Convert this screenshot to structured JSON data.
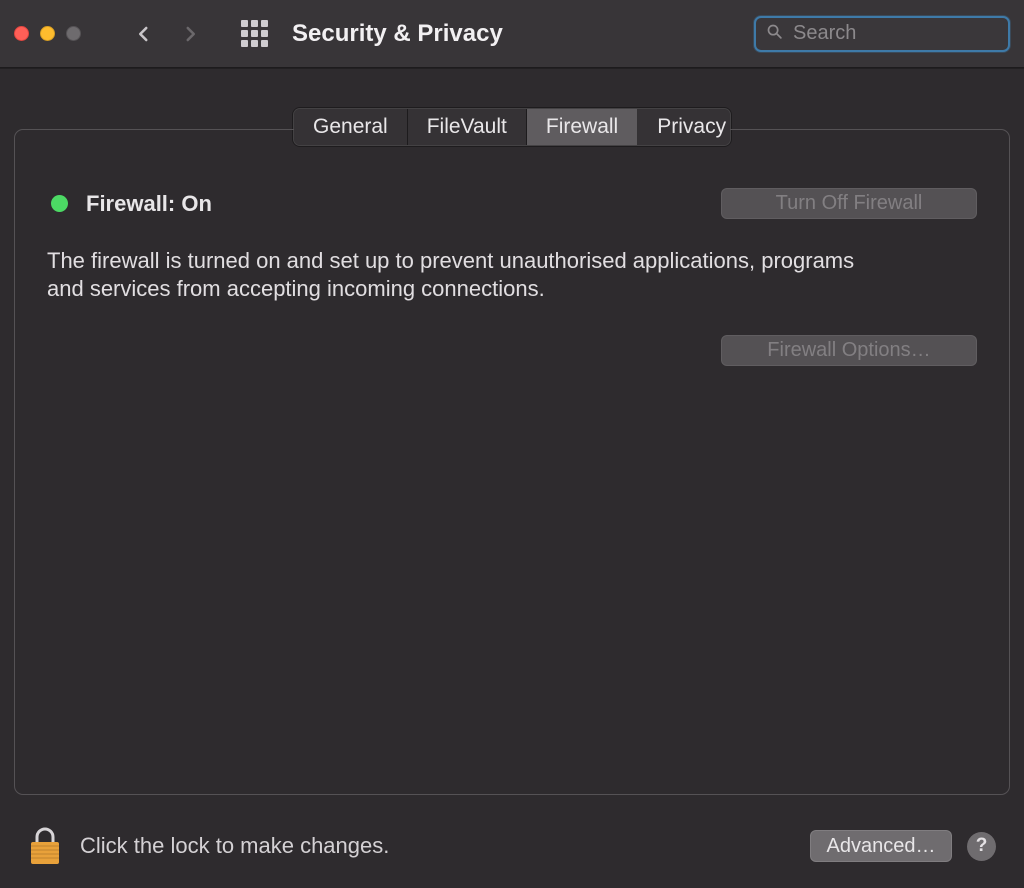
{
  "window": {
    "title": "Security & Privacy"
  },
  "search": {
    "placeholder": "Search"
  },
  "tabs": {
    "general": "General",
    "filevault": "FileVault",
    "firewall": "Firewall",
    "privacy": "Privacy",
    "active": "firewall"
  },
  "firewall": {
    "status_label": "Firewall: On",
    "status_color": "#4cd964",
    "turn_off_label": "Turn Off Firewall",
    "description": "The firewall is turned on and set up to prevent unauthorised applications, programs and services from accepting incoming connections.",
    "options_label": "Firewall Options…"
  },
  "footer": {
    "lock_text": "Click the lock to make changes.",
    "advanced_label": "Advanced…",
    "help_label": "?"
  }
}
